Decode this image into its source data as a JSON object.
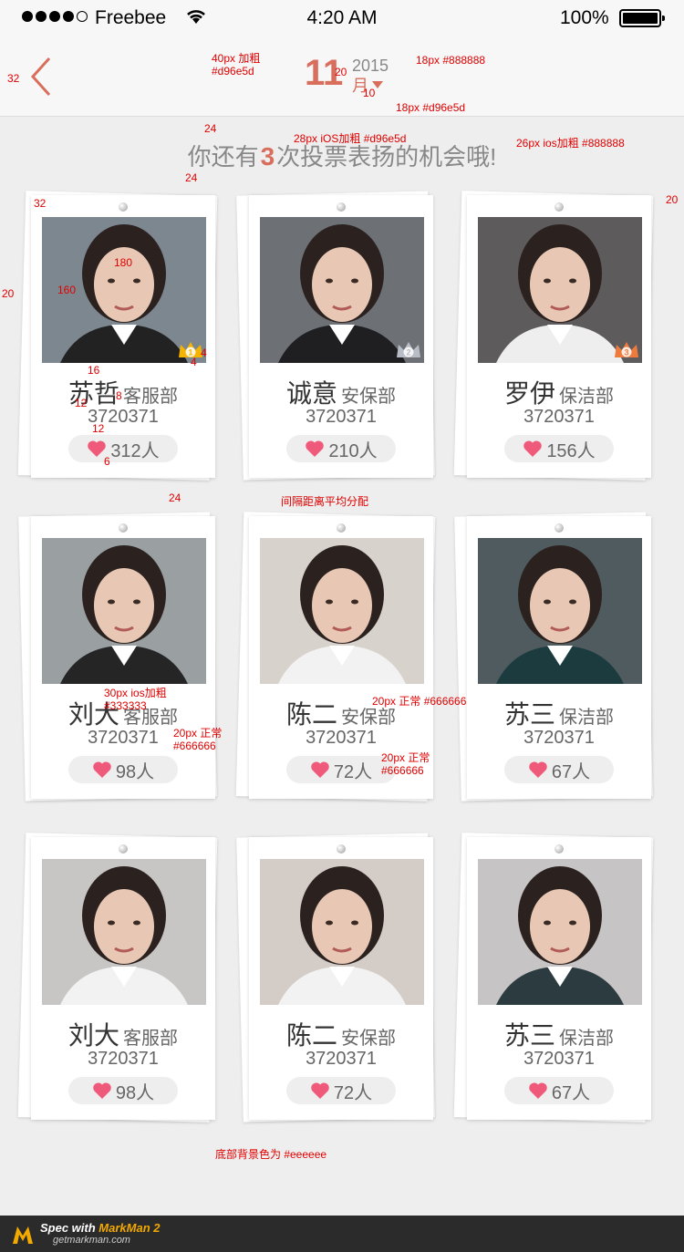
{
  "status_bar": {
    "carrier": "Freebee",
    "time": "4:20 AM",
    "battery": "100%"
  },
  "header": {
    "month_num": "11",
    "year": "2015",
    "month_label": "月"
  },
  "vote_banner": {
    "prefix": "你还有",
    "count": "3",
    "suffix": "次投票表扬的机会哦!"
  },
  "colors": {
    "accent": "#d96e5d",
    "gray": "#888888",
    "name_color": "#333333",
    "sub_color": "#666666",
    "bg": "#eeeeee"
  },
  "cards": [
    {
      "name": "苏哲",
      "dept": "客服部",
      "phone": "3720371",
      "likes": "312人",
      "crown": "1",
      "crown_color": "#f4b400"
    },
    {
      "name": "诚意",
      "dept": "安保部",
      "phone": "3720371",
      "likes": "210人",
      "crown": "2",
      "crown_color": "#b8bcc4"
    },
    {
      "name": "罗伊",
      "dept": "保洁部",
      "phone": "3720371",
      "likes": "156人",
      "crown": "3",
      "crown_color": "#ee7a3c"
    },
    {
      "name": "刘大",
      "dept": "客服部",
      "phone": "3720371",
      "likes": "98人"
    },
    {
      "name": "陈二",
      "dept": "安保部",
      "phone": "3720371",
      "likes": "72人"
    },
    {
      "name": "苏三",
      "dept": "保洁部",
      "phone": "3720371",
      "likes": "67人"
    },
    {
      "name": "刘大",
      "dept": "客服部",
      "phone": "3720371",
      "likes": "98人"
    },
    {
      "name": "陈二",
      "dept": "安保部",
      "phone": "3720371",
      "likes": "72人"
    },
    {
      "name": "苏三",
      "dept": "保洁部",
      "phone": "3720371",
      "likes": "67人"
    }
  ],
  "annotations": {
    "a_left32": "32",
    "a_month": "40px 加粗\n#d96e5d",
    "a_20a": "20",
    "a_year": "18px #888888",
    "a_10": "10",
    "a_monthlabel": "18px #d96e5d",
    "a_24a": "24",
    "a_vote": "28px iOS加粗  #d96e5d",
    "a_vote2": "26px ios加粗  #888888",
    "a_24b": "24",
    "a_32": "32",
    "a_20r": "20",
    "a_20l": "20",
    "a_180": "180",
    "a_160": "160",
    "a_4a": "4",
    "a_4b": "4",
    "a_16": "16",
    "a_8": "8",
    "a_12a": "12",
    "a_12b": "12",
    "a_6": "6",
    "a_24c": "24",
    "a_spacing": "间隔距离平均分配",
    "a_name": "30px ios加粗\n#333333",
    "a_dept": "20px 正常 #666666",
    "a_phone": "20px 正常\n#666666",
    "a_likes": "20px 正常\n#666666",
    "a_bottom": "底部背景色为 #eeeeee"
  },
  "footer": {
    "title_prefix": "Spec with ",
    "title_brand": "MarkMan 2",
    "subtitle": "getmarkman.com"
  }
}
